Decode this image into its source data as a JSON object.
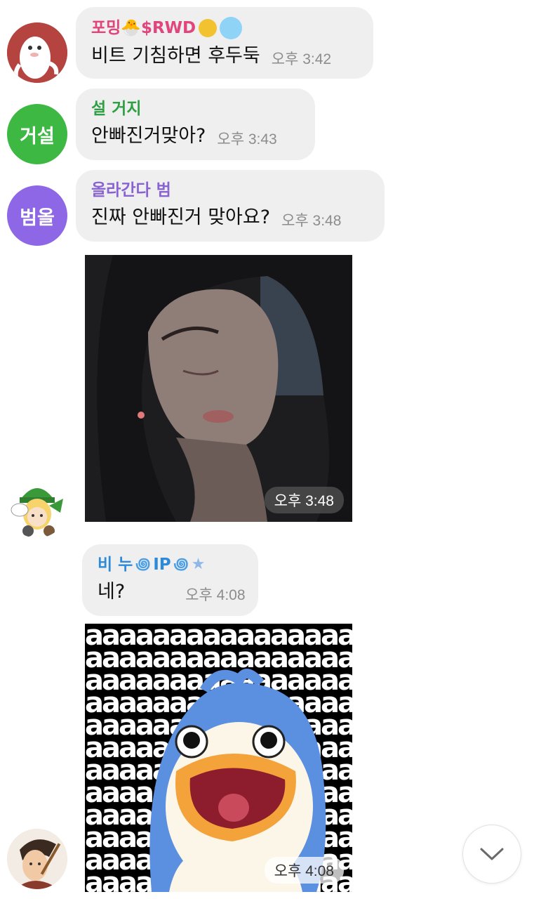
{
  "messages": [
    {
      "sender": "포밍🐣$RWD",
      "text": "비트 기침하면 후두둑",
      "time": "오후 3:42",
      "sender_color": "#e0457b"
    },
    {
      "sender": "설 거지",
      "avatar_label": "거설",
      "text": "안빠진거맞아?",
      "time": "오후 3:43",
      "sender_color": "#2ea043",
      "avatar_color": "#3cb843"
    },
    {
      "sender": "올라간다 범",
      "avatar_label": "범올",
      "text": "진짜 안빠진거 맞아요?",
      "time": "오후 3:48",
      "sender_color": "#8a63d2",
      "avatar_color": "#8e67e6"
    },
    {
      "media_time": "오후 3:48"
    },
    {
      "sender_prefix": "비 누",
      "sender_ip": "IP",
      "text": "네?",
      "time": "오후 4:08",
      "sender_color": "#2d8ad8"
    },
    {
      "media_time": "오후 4:08",
      "sticker_letter": "a"
    }
  ]
}
